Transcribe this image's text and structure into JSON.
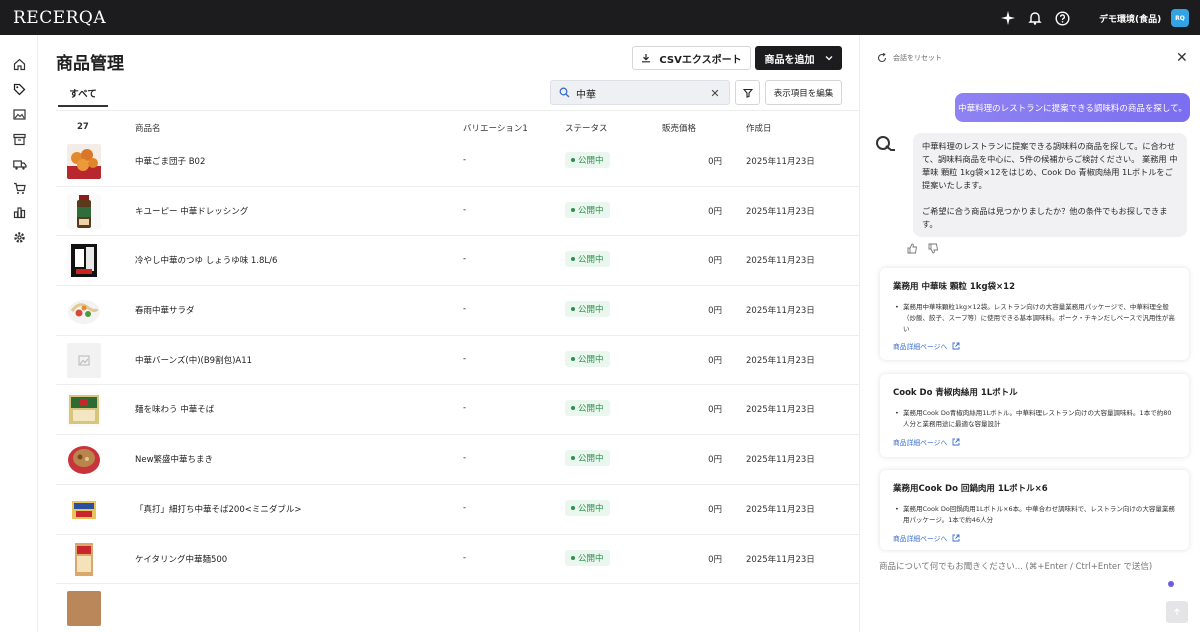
{
  "app": {
    "logo": "RECERQA"
  },
  "topbar": {
    "environment": "デモ環境(食品)",
    "avatar_initials": "RQ",
    "icons": [
      "sparkle-icon",
      "bell-icon",
      "help-icon"
    ]
  },
  "sidebar": {
    "items": [
      "home-icon",
      "tag-icon",
      "images-icon",
      "archive-icon",
      "truck-icon",
      "cart-icon",
      "chart-icon",
      "settings-icon"
    ]
  },
  "page": {
    "title": "商品管理",
    "csv_export_label": "CSVエクスポート",
    "add_product_label": "商品を追加",
    "tab_all": "すべて",
    "search_value": "中華",
    "edit_columns_label": "表示項目を編集"
  },
  "table": {
    "count": "27",
    "columns": {
      "name": "商品名",
      "variation": "バリエーション1",
      "status": "ステータス",
      "price": "販売価格",
      "created": "作成日"
    },
    "rows": [
      {
        "name": "中華ごま団子 B02",
        "variation": "-",
        "status": "公開中",
        "price": "0円",
        "created": "2025年11月23日"
      },
      {
        "name": "キユーピー 中華ドレッシング",
        "variation": "-",
        "status": "公開中",
        "price": "0円",
        "created": "2025年11月23日"
      },
      {
        "name": "冷やし中華のつゆ しょうゆ味 1.8L/6",
        "variation": "-",
        "status": "公開中",
        "price": "0円",
        "created": "2025年11月23日"
      },
      {
        "name": "春雨中華サラダ",
        "variation": "-",
        "status": "公開中",
        "price": "0円",
        "created": "2025年11月23日"
      },
      {
        "name": "中華バーンズ(中)(B9割包)A11",
        "variation": "-",
        "status": "公開中",
        "price": "0円",
        "created": "2025年11月23日"
      },
      {
        "name": "麺を味わう 中華そば",
        "variation": "-",
        "status": "公開中",
        "price": "0円",
        "created": "2025年11月23日"
      },
      {
        "name": "New繁盛中華ちまき",
        "variation": "-",
        "status": "公開中",
        "price": "0円",
        "created": "2025年11月23日"
      },
      {
        "name": "「真打」細打ち中華そば200<ミニダブル>",
        "variation": "-",
        "status": "公開中",
        "price": "0円",
        "created": "2025年11月23日"
      },
      {
        "name": "ケイタリング中華麺500",
        "variation": "-",
        "status": "公開中",
        "price": "0円",
        "created": "2025年11月23日"
      }
    ]
  },
  "chat": {
    "reset_label": "会話をリセット",
    "user_message": "中華料理のレストランに提案できる調味料の商品を探して。",
    "bot_message_1": "中華料理のレストランに提案できる調味料の商品を探して。に合わせて、調味料商品を中心に、5件の候補からご検討ください。 業務用 中華味 顆粒 1kg袋×12をはじめ、Cook Do 青椒肉絲用 1Lボトルをご提案いたします。",
    "bot_message_2": "ご希望に合う商品は見つかりましたか？他の条件でもお探しできます。",
    "link_label": "商品詳細ページへ",
    "cards": [
      {
        "title": "業務用 中華味 顆粒 1kg袋×12",
        "description": "業務用中華味顆粒1kg×12袋。レストラン向けの大容量業務用パッケージで、中華料理全般（炒飯、餃子、スープ等）に使用できる基本調味料。ポーク・チキンだしベースで汎用性が高い"
      },
      {
        "title": "Cook Do 青椒肉絲用 1Lボトル",
        "description": "業務用Cook Do青椒肉絲用1Lボトル。中華料理レストラン向けの大容量調味料。1本で約80人分と業務用途に最適な容量設計"
      },
      {
        "title": "業務用Cook Do 回鍋肉用 1Lボトル×6",
        "description": "業務用Cook Do回鍋肉用1Lボトル×6本。中華合わせ調味料で、レストラン向けの大容量業務用パッケージ。1本で約46人分"
      }
    ],
    "input_placeholder": "商品について何でもお聞きください... (⌘+Enter / Ctrl+Enter で送信)"
  },
  "colors": {
    "topbar": "#1c1c1e",
    "accent": "#7b6ef0",
    "status_green": "#2f8f4e",
    "avatar_blue": "#34a3e6"
  }
}
